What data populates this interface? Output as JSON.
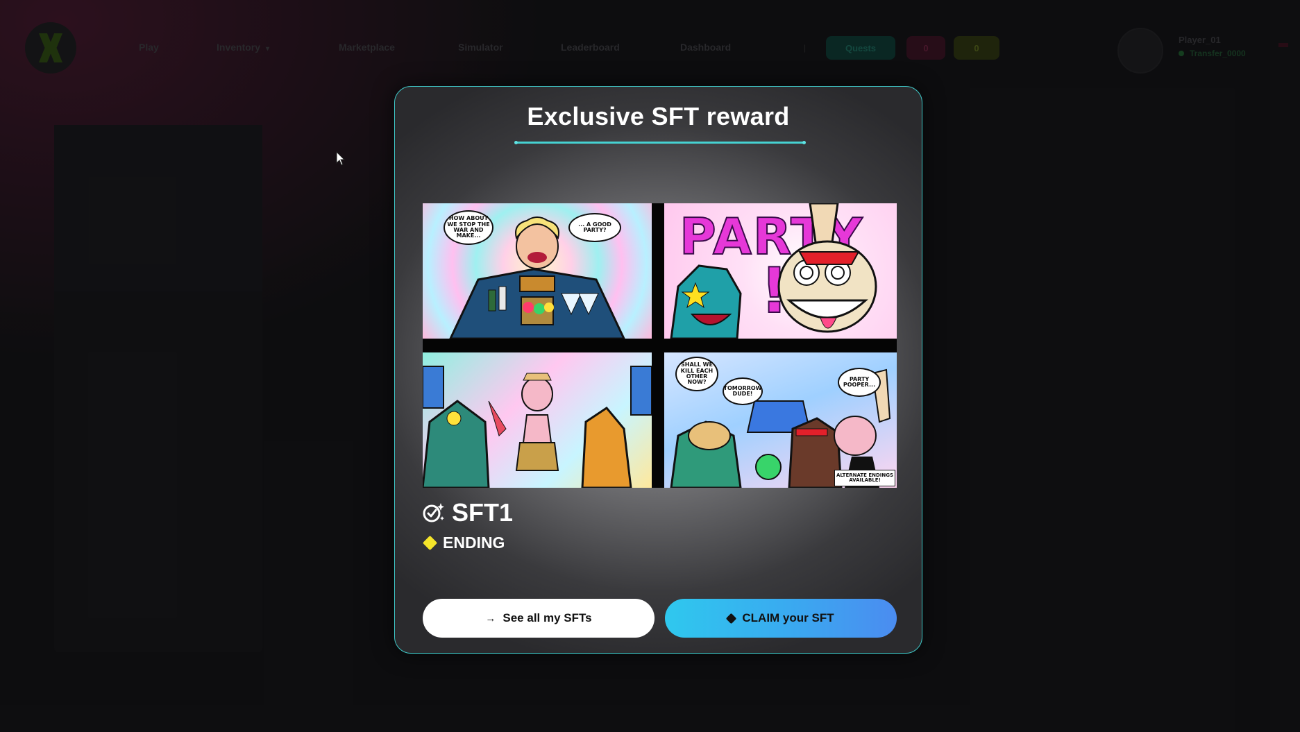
{
  "background_app": {
    "nav_items": [
      "Play",
      "Inventory",
      "Marketplace",
      "Simulator",
      "Leaderboard",
      "Dashboard"
    ],
    "badges": {
      "green": "Quests",
      "red": "0",
      "yellow": "0"
    },
    "user": {
      "name": "Player_01",
      "balance": "Transfer_0000"
    }
  },
  "modal": {
    "title": "Exclusive SFT reward",
    "artwork": {
      "bubble_1": "HOW ABOUT WE STOP THE WAR AND MAKE...",
      "bubble_2": "... A GOOD PARTY?",
      "party_word": "PARTY",
      "party_bang": "!",
      "bubble_3": "SHALL WE KILL EACH OTHER NOW?",
      "bubble_4": "TOMORROW DUDE!",
      "bubble_5": "PARTY POOPER...",
      "caption": "ALTERNATE ENDINGS AVAILABLE!"
    },
    "sft_name": "SFT1",
    "status": "ENDING",
    "buttons": {
      "see_all_label": "See all my SFTs",
      "see_all_icon": "arrow-right-icon",
      "claim_label": "CLAIM your SFT",
      "claim_icon": "diamond-icon"
    }
  },
  "colors": {
    "accent_border": "#3fc8c8",
    "status_diamond": "#f5e52a",
    "claim_gradient_start": "#2fc8ee",
    "claim_gradient_end": "#4b8cf0"
  }
}
